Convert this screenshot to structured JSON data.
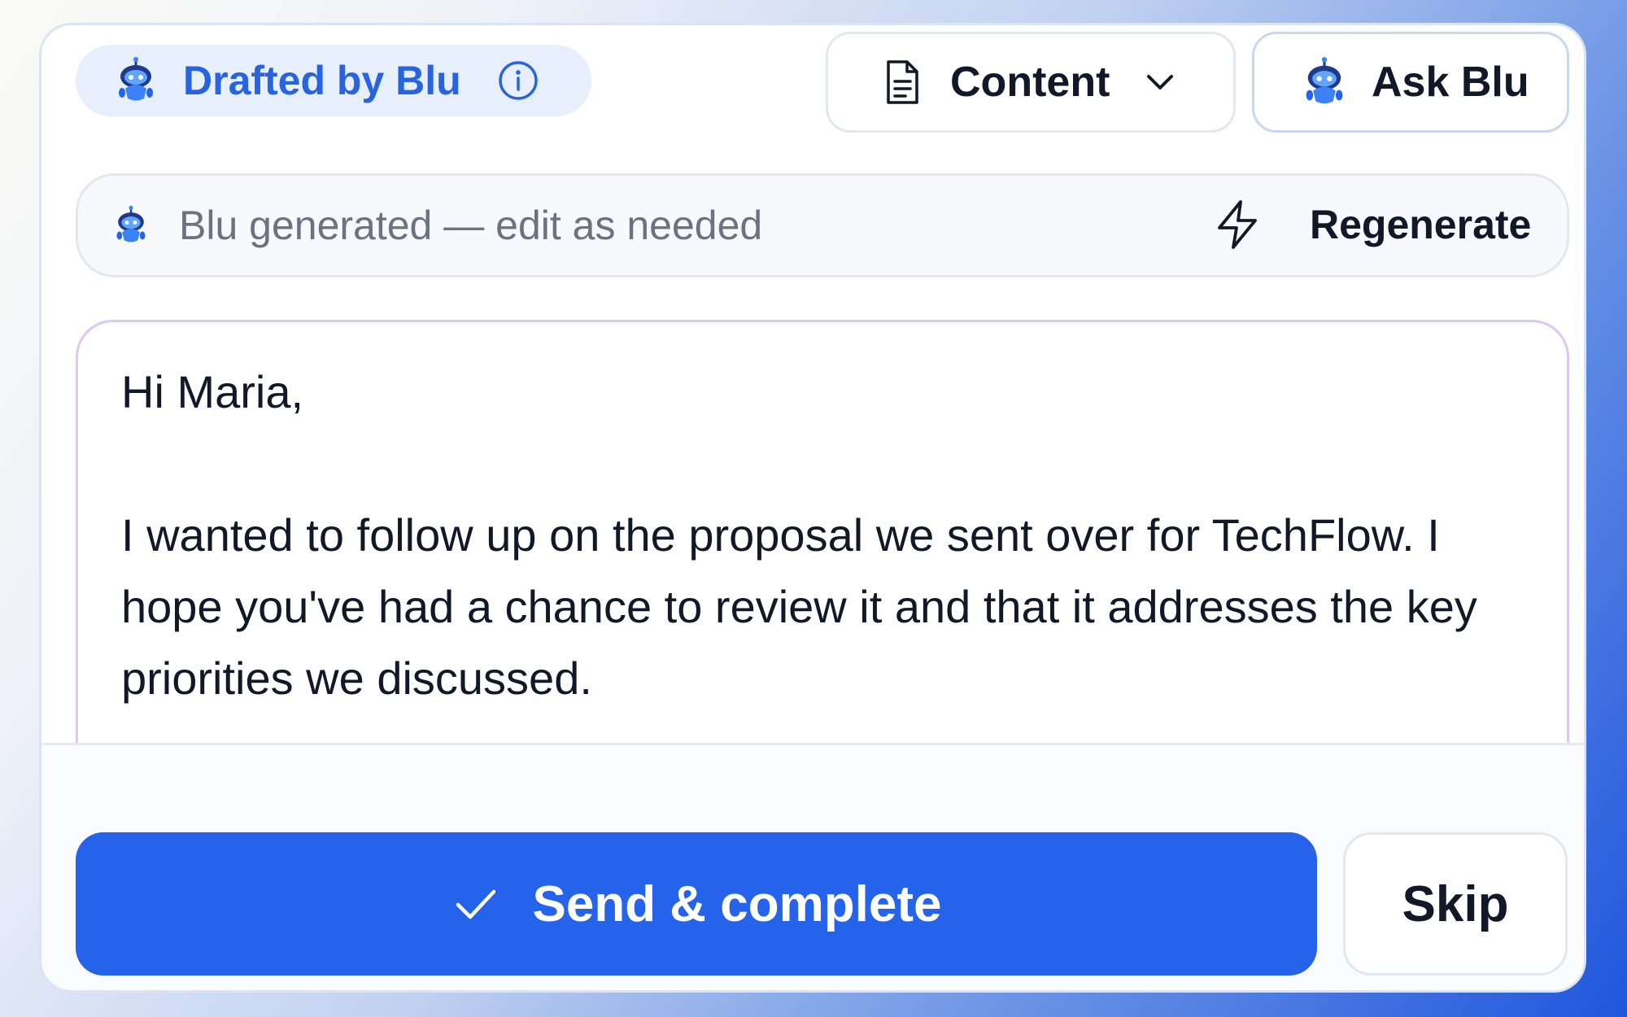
{
  "header": {
    "badge_label": "Drafted by Blu",
    "content_menu_label": "Content",
    "ask_button_label": "Ask Blu"
  },
  "generated_bar": {
    "text": "Blu generated — edit as needed",
    "regenerate_label": "Regenerate"
  },
  "editor": {
    "greeting": "Hi Maria,",
    "body": "I wanted to follow up on the proposal we sent over for TechFlow. I hope you've had a chance to review it and that it addresses the key priorities we discussed."
  },
  "footer": {
    "send_label": "Send & complete",
    "skip_label": "Skip"
  },
  "icons": {
    "mascot": "blu-robot-icon",
    "info": "info-icon",
    "document": "document-icon",
    "chevron": "chevron-down-icon",
    "bolt": "lightning-icon",
    "check": "check-icon"
  },
  "colors": {
    "accent": "#2563eb",
    "badge_text": "#2864df",
    "badge_bg": "#e7effd",
    "editor_border": "#dcc7f5"
  }
}
